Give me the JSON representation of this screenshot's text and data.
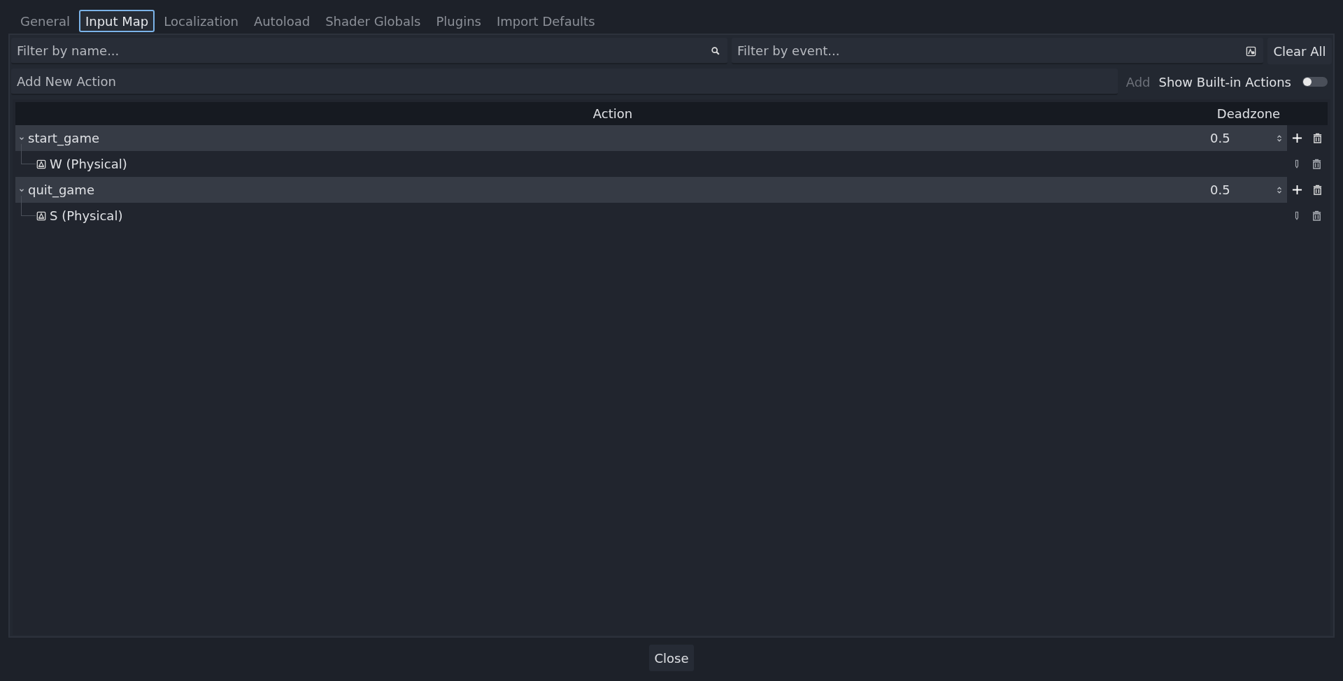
{
  "tabs": [
    {
      "label": "General",
      "selected": false
    },
    {
      "label": "Input Map",
      "selected": true
    },
    {
      "label": "Localization",
      "selected": false
    },
    {
      "label": "Autoload",
      "selected": false
    },
    {
      "label": "Shader Globals",
      "selected": false
    },
    {
      "label": "Plugins",
      "selected": false
    },
    {
      "label": "Import Defaults",
      "selected": false
    }
  ],
  "filters": {
    "name_placeholder": "Filter by name...",
    "event_placeholder": "Filter by event...",
    "clear_button": "Clear All"
  },
  "add_action": {
    "placeholder": "Add New Action",
    "add_button": "Add",
    "add_disabled": true,
    "builtin_label": "Show Built-in Actions",
    "builtin_on": false
  },
  "table": {
    "columns": [
      "Action",
      "Deadzone"
    ],
    "actions": [
      {
        "name": "start_game",
        "expanded": true,
        "deadzone": "0.5",
        "children": [
          {
            "label": "W (Physical)"
          }
        ]
      },
      {
        "name": "quit_game",
        "expanded": true,
        "deadzone": "0.5",
        "children": [
          {
            "label": "S (Physical)"
          }
        ]
      }
    ]
  },
  "close_button": "Close"
}
